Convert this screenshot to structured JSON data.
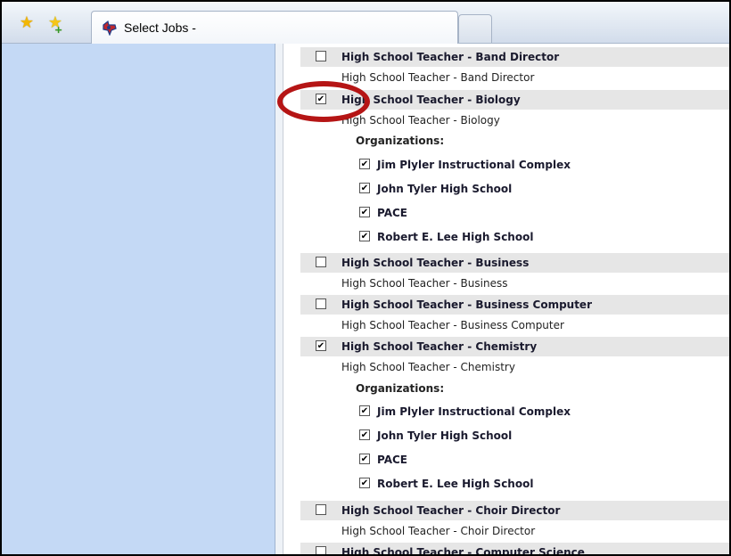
{
  "browser": {
    "tab_title": "Select Jobs -"
  },
  "jobs": [
    {
      "title": "High School Teacher - Band Director",
      "description": "High School Teacher - Band Director",
      "checked": false
    },
    {
      "title": "High School Teacher - Biology",
      "description": "High School Teacher - Biology",
      "checked": true,
      "organizations_label": "Organizations:",
      "organizations": [
        {
          "name": "Jim Plyler Instructional Complex",
          "checked": true
        },
        {
          "name": "John Tyler High School",
          "checked": true
        },
        {
          "name": "PACE",
          "checked": true
        },
        {
          "name": "Robert E. Lee High School",
          "checked": true
        }
      ]
    },
    {
      "title": "High School Teacher - Business",
      "description": "High School Teacher - Business",
      "checked": false
    },
    {
      "title": "High School Teacher - Business Computer",
      "description": "High School Teacher - Business Computer",
      "checked": false
    },
    {
      "title": "High School Teacher - Chemistry",
      "description": "High School Teacher - Chemistry",
      "checked": true,
      "organizations_label": "Organizations:",
      "organizations": [
        {
          "name": "Jim Plyler Instructional Complex",
          "checked": true
        },
        {
          "name": "John Tyler High School",
          "checked": true
        },
        {
          "name": "PACE",
          "checked": true
        },
        {
          "name": "Robert E. Lee High School",
          "checked": true
        }
      ]
    },
    {
      "title": "High School Teacher - Choir Director",
      "description": "High School Teacher - Choir Director",
      "checked": false
    },
    {
      "title": "High School Teacher - Computer Science",
      "checked": false
    }
  ],
  "colors": {
    "sidebar": "#c4d9f5",
    "row_header": "#e6e6e6",
    "highlight_circle": "#b51515"
  }
}
